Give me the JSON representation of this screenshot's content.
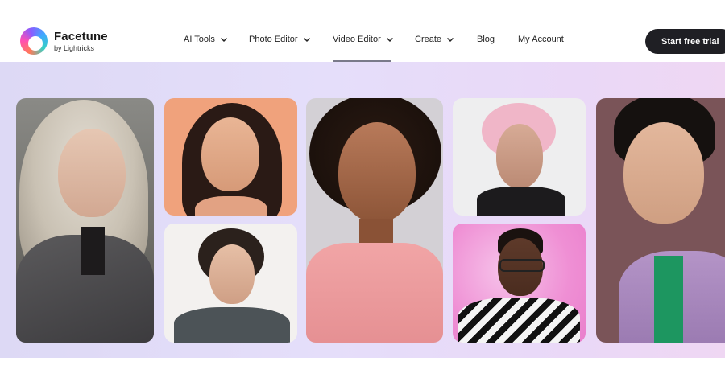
{
  "brand": {
    "name": "Facetune",
    "sub": "by Lightricks"
  },
  "nav": {
    "items": [
      {
        "label": "AI Tools",
        "has_dropdown": true
      },
      {
        "label": "Photo Editor",
        "has_dropdown": true
      },
      {
        "label": "Video Editor",
        "has_dropdown": true,
        "active": true
      },
      {
        "label": "Create",
        "has_dropdown": true
      },
      {
        "label": "Blog",
        "has_dropdown": false
      },
      {
        "label": "My Account",
        "has_dropdown": false
      }
    ]
  },
  "cta": {
    "label": "Start free trial"
  },
  "colors": {
    "accent": "#1f1f24",
    "hero_bg": "#e3ddf8"
  },
  "hero": {
    "photos": [
      {
        "name": "portrait-woman-gray-hair"
      },
      {
        "name": "portrait-woman-orange-bg"
      },
      {
        "name": "portrait-woman-curly-hair"
      },
      {
        "name": "portrait-woman-pink-shirt"
      },
      {
        "name": "portrait-person-pink-hair"
      },
      {
        "name": "portrait-man-glasses"
      },
      {
        "name": "portrait-man-denim-jacket"
      }
    ]
  }
}
